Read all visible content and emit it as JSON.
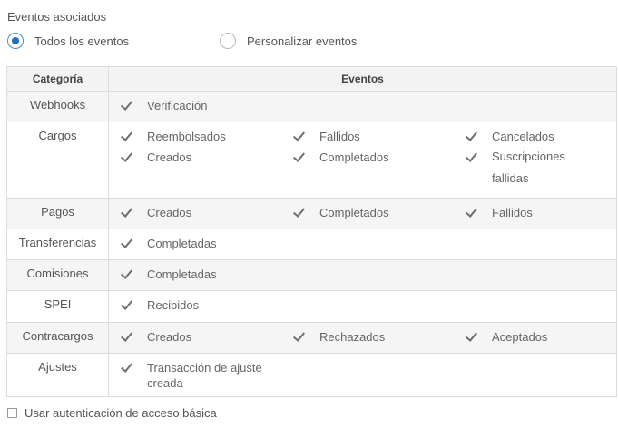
{
  "section": {
    "title": "Eventos asociados"
  },
  "radios": [
    {
      "label": "Todos los eventos",
      "checked": true
    },
    {
      "label": "Personalizar eventos",
      "checked": false
    }
  ],
  "table": {
    "headers": [
      "Categoría",
      "Eventos"
    ],
    "rows": [
      {
        "category": "Webhooks",
        "events": [
          "Verificación"
        ]
      },
      {
        "category": "Cargos",
        "events": [
          "Reembolsados",
          "Fallidos",
          "Cancelados",
          "Creados",
          "Completados",
          "Suscripciones fallidas"
        ]
      },
      {
        "category": "Pagos",
        "events": [
          "Creados",
          "Completados",
          "Fallidos"
        ]
      },
      {
        "category": "Transferencias",
        "events": [
          "Completadas"
        ]
      },
      {
        "category": "Comisiones",
        "events": [
          "Completadas"
        ]
      },
      {
        "category": "SPEI",
        "events": [
          "Recibidos"
        ]
      },
      {
        "category": "Contracargos",
        "events": [
          "Creados",
          "Rechazados",
          "Aceptados"
        ]
      },
      {
        "category": "Ajustes",
        "events": [
          "Transacción de ajuste creada"
        ]
      }
    ]
  },
  "basic_auth": {
    "label": "Usar autenticación de acceso básica",
    "checked": false
  },
  "colors": {
    "accent": "#1f6fc2",
    "border": "#dcdcdc",
    "header_bg": "#f3f3f3"
  }
}
